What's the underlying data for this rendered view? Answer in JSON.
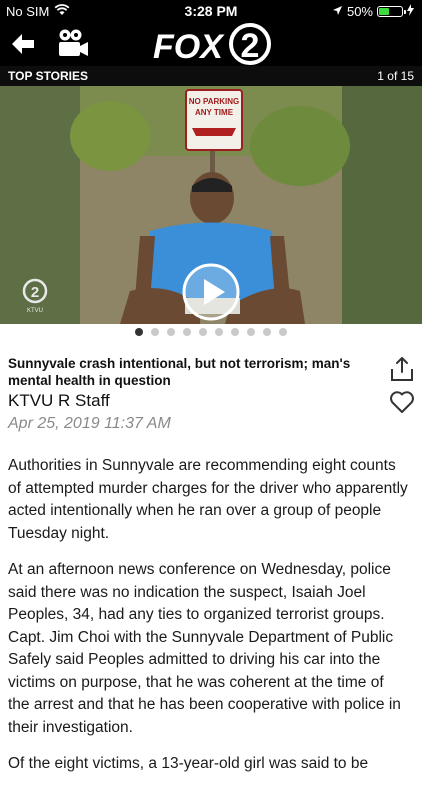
{
  "status_bar": {
    "carrier": "No SIM",
    "time": "3:28 PM",
    "battery": "50%",
    "battery_level": 0.5,
    "icons": [
      "wifi-icon",
      "location-arrow-icon",
      "battery-icon",
      "charging-bolt-icon"
    ]
  },
  "header": {
    "logo_text": "FOX",
    "logo_number": "2",
    "icons": [
      "back-arrow-icon",
      "video-camera-icon"
    ]
  },
  "section": {
    "title": "TOP STORIES",
    "counter": "1 of 15"
  },
  "hero": {
    "sign_line1": "NO PARKING",
    "sign_line2": "ANY TIME",
    "watermark": "2",
    "watermark_sub": "KTVU"
  },
  "carousel": {
    "total_dots": 10,
    "active_index": 0
  },
  "article": {
    "headline": "Sunnyvale crash intentional, but not terrorism; man's mental health in question",
    "author": "KTVU R Staff",
    "date": "Apr 25, 2019 11:37 AM",
    "paragraphs": [
      "Authorities in Sunnyvale are recommending eight counts of attempted murder charges for the driver who apparently acted intentionally when he ran over a group of people Tuesday night.",
      "At an afternoon news conference on Wednesday, police said there was no indication the suspect, Isaiah Joel Peoples, 34, had any ties to organized terrorist groups. Capt. Jim Choi with the Sunnyvale Department of Public Safely said Peoples admitted to driving his car into the victims on purpose, that he was coherent at the time of the arrest and that he has been cooperative with police in their investigation.",
      "Of the eight victims, a 13-year-old girl was said to be"
    ]
  },
  "colors": {
    "bar": "#000000",
    "battery_fill": "#3ddc3d",
    "date_gray": "#8a8a8a",
    "shirt_blue": "#3a8fd8"
  }
}
